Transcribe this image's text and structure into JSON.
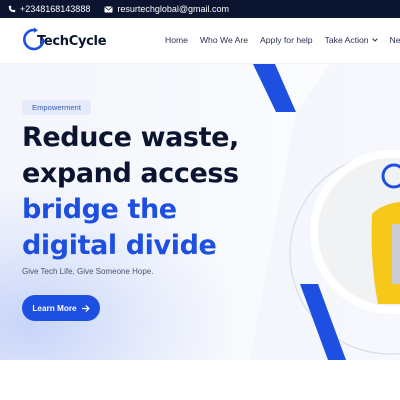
{
  "topbar": {
    "phone": "+2348168143888",
    "email": "resurtechglobal@gmail.com",
    "phone_icon": "phone-icon",
    "email_icon": "mail-icon"
  },
  "brand": {
    "name": "TechCycle",
    "logo_icon": "recycle-logo-icon"
  },
  "nav": {
    "items": [
      {
        "label": "Home"
      },
      {
        "label": "Who We Are"
      },
      {
        "label": "Apply for help"
      },
      {
        "label": "Take Action",
        "dropdown": true
      },
      {
        "label": "News"
      }
    ]
  },
  "hero": {
    "badge": "Empowerment",
    "headline_dark": [
      "Reduce waste,",
      "expand access"
    ],
    "headline_blue": [
      "bridge the",
      "digital divide"
    ],
    "tagline": "Give Tech Life, Give Someone Hope.",
    "cta_label": "Learn More",
    "cta_icon": "arrow-right-icon"
  },
  "colors": {
    "navy": "#0b1530",
    "brand_blue": "#1d4fe0",
    "badge_bg": "#e4eaf9",
    "accent_yellow": "#f5c81a"
  }
}
